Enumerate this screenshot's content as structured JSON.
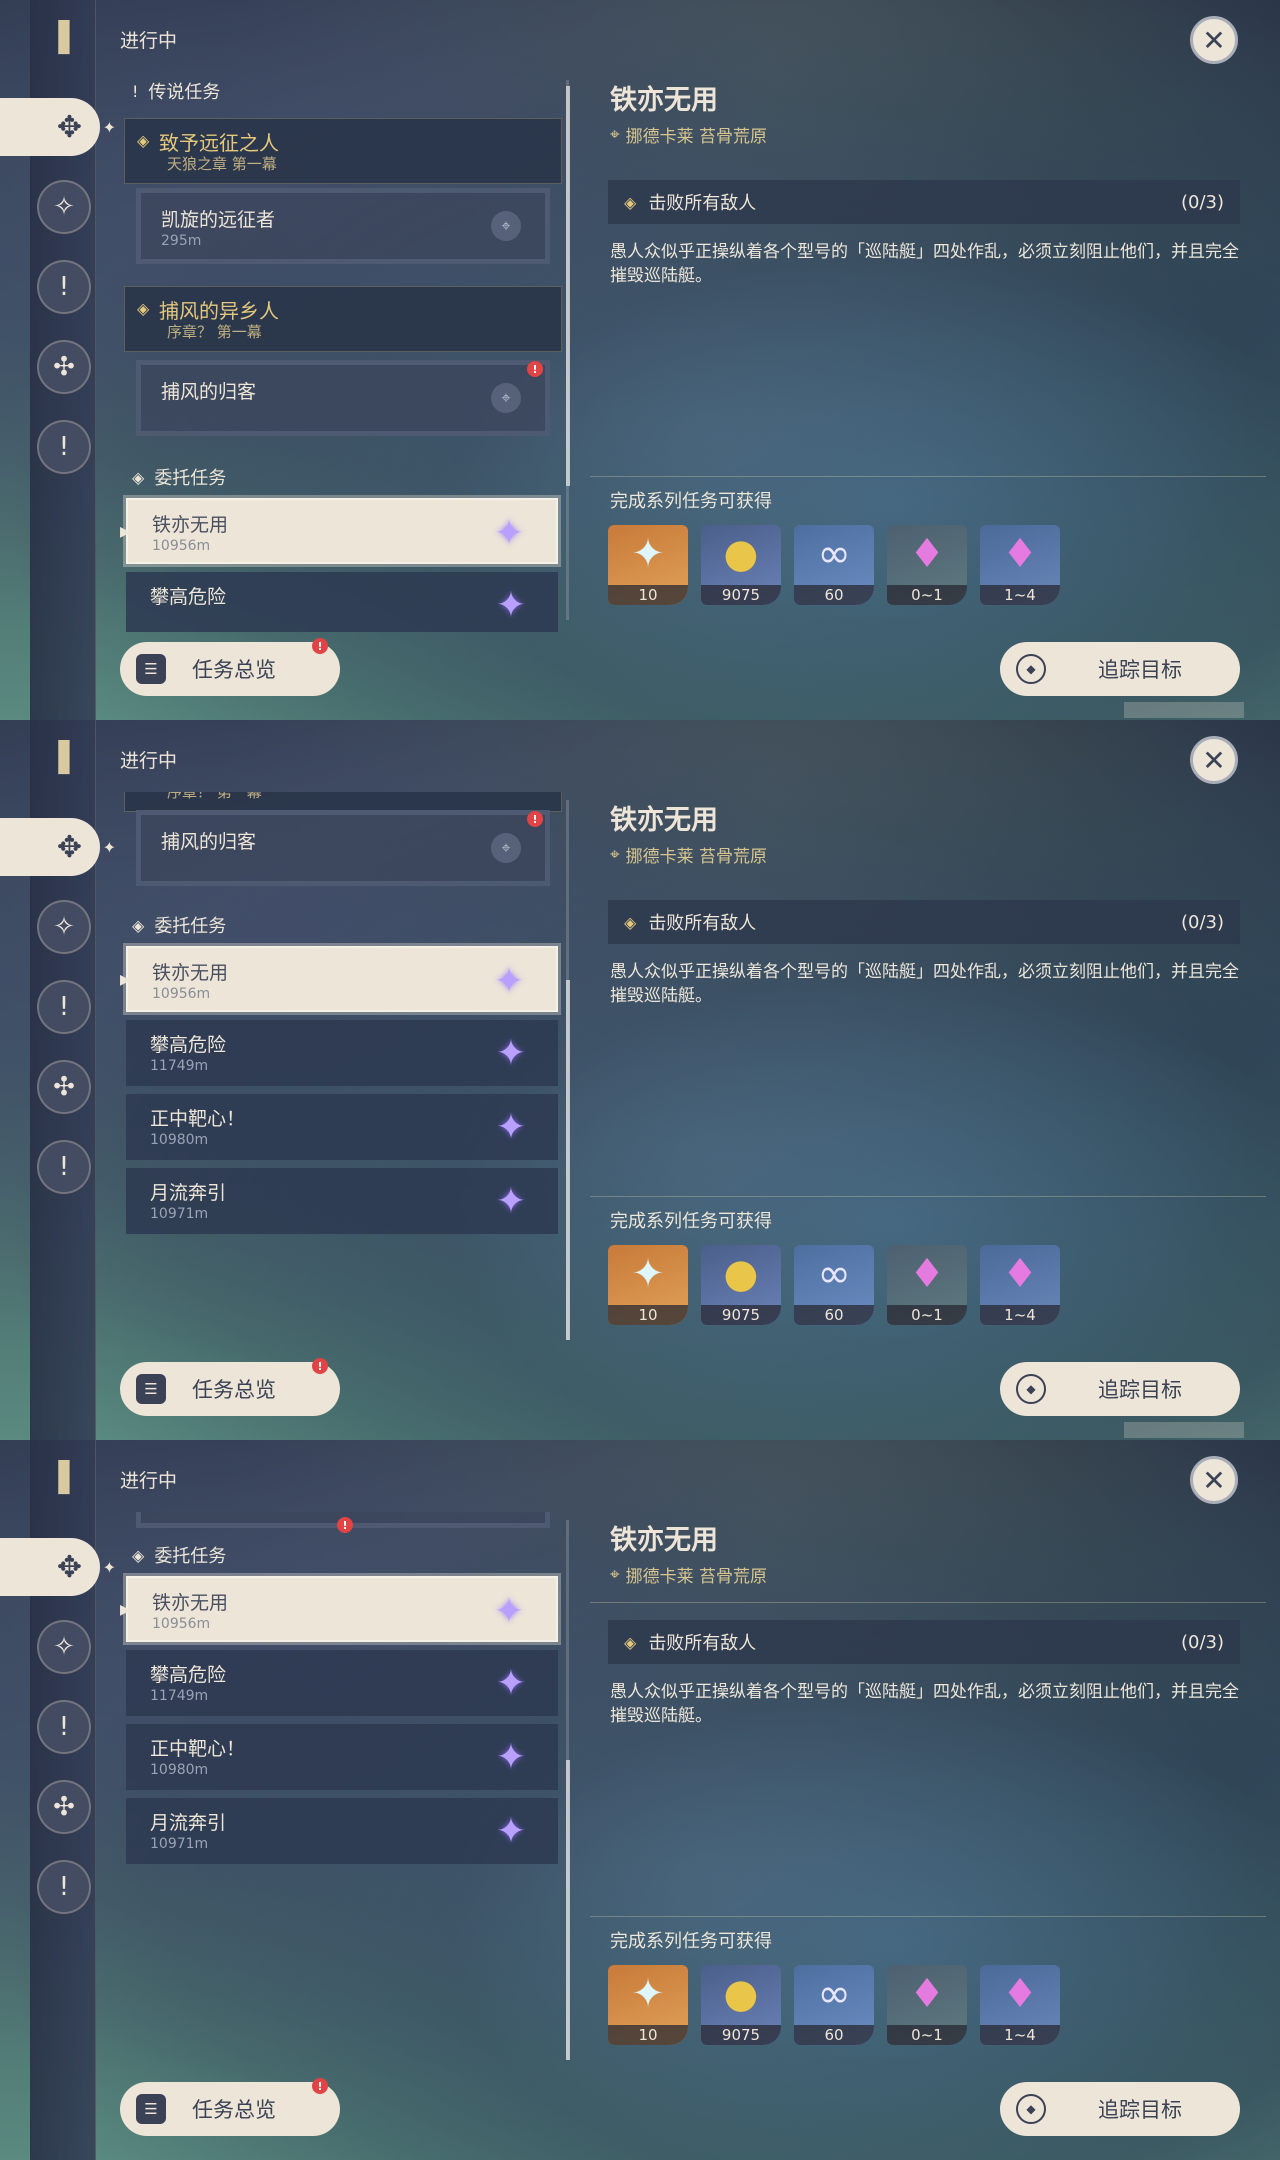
{
  "common": {
    "in_progress": "进行中",
    "legend_section": "传说任务",
    "commission_section": "委托任务",
    "overview_button": "任务总览",
    "track_button": "追踪目标",
    "detail": {
      "title": "铁亦无用",
      "location": "挪德卡莱 苔骨荒原",
      "objective": "击败所有敌人",
      "objective_count": "(0/3)",
      "description": "愚人众似乎正操纵着各个型号的「巡陆艇」四处作乱，必须立刻阻止他们，并且完全摧毁巡陆艇。",
      "rewards_label": "完成系列任务可获得",
      "rewards": [
        {
          "icon": "primogem-icon",
          "glyph": "✦",
          "qty": "10",
          "style": "r-gold"
        },
        {
          "icon": "mora-icon",
          "glyph": "●",
          "qty": "9075",
          "style": "r-blue"
        },
        {
          "icon": "fate-icon",
          "glyph": "∞",
          "qty": "60",
          "style": "r-purple"
        },
        {
          "icon": "crystal-icon",
          "glyph": "♦",
          "qty": "0~1",
          "style": "r-green"
        },
        {
          "icon": "crystal-cluster-icon",
          "glyph": "♦",
          "qty": "1~4",
          "style": "r-violet"
        }
      ]
    }
  },
  "quests": {
    "legend1": {
      "title": "致予远征之人",
      "subtitle": "天狼之章 第一幕",
      "child": "凯旋的远征者",
      "child_dist": "295m"
    },
    "legend2": {
      "title": "捕风的异乡人",
      "subtitle": "序章？ 第一幕",
      "child": "捕风的归客"
    },
    "commissions": [
      {
        "title": "铁亦无用",
        "dist": "10956m"
      },
      {
        "title": "攀高危险",
        "dist": "11749m"
      },
      {
        "title": "正中靶心！",
        "dist": "10980m"
      },
      {
        "title": "月流奔引",
        "dist": "10971m"
      }
    ]
  },
  "colors": {
    "cream": "#ece5d8",
    "gold": "#e3c77c",
    "dark": "#3b4255",
    "alert": "#e04444"
  }
}
